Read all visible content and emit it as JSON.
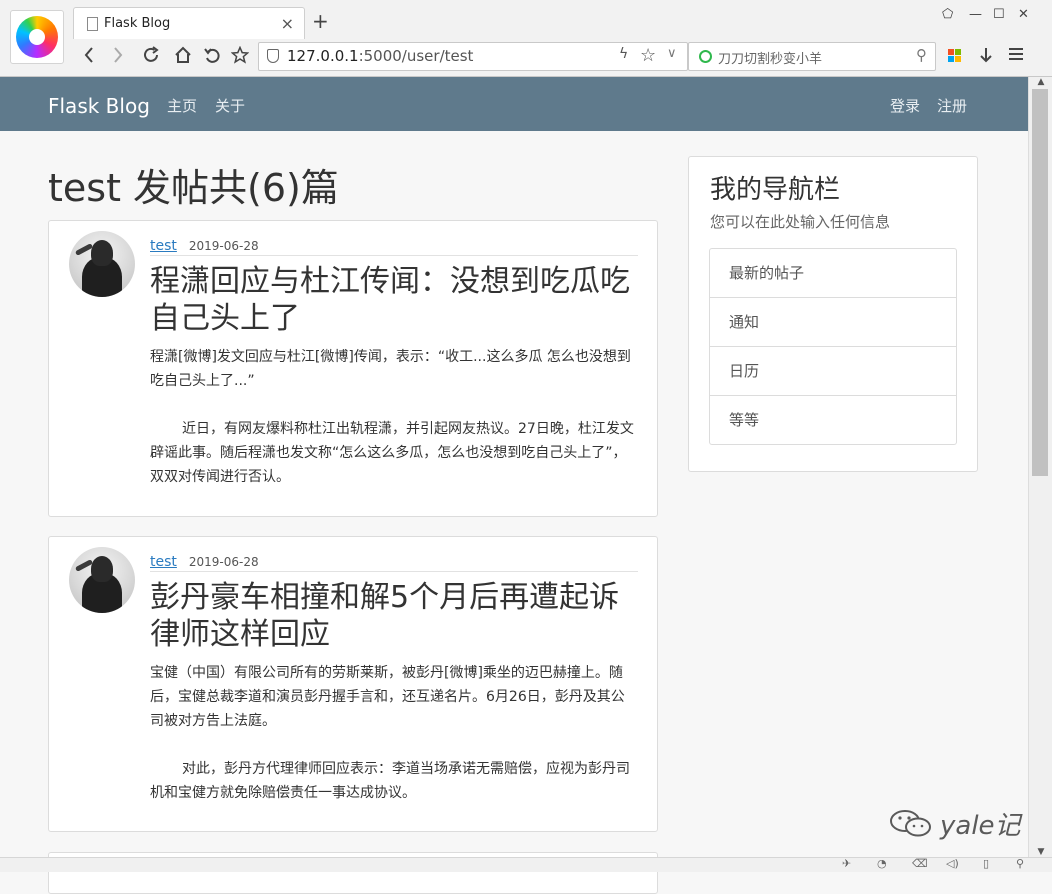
{
  "browser": {
    "tab_title": "Flask Blog",
    "tab_close": "×",
    "new_tab": "+",
    "url_host": "127.0.0.1",
    "url_rest": ":5000/user/test",
    "search_text": "刀刀切割秒变小羊",
    "window_controls": [
      "⬠",
      "—",
      "☐",
      "✕"
    ],
    "nav_icons": [
      "back-arrow-icon",
      "forward-arrow-icon",
      "refresh-icon",
      "home-icon",
      "undo-icon",
      "bookmark-star-icon"
    ]
  },
  "navbar": {
    "brand": "Flask Blog",
    "links": [
      "主页",
      "关于"
    ],
    "right_links": [
      "登录",
      "注册"
    ],
    "bg_color": "#5f7a8c"
  },
  "main": {
    "heading": "test 发帖共(6)篇"
  },
  "posts": [
    {
      "author": "test",
      "date": "2019-06-28",
      "title": "程潇回应与杜江传闻：没想到吃瓜吃自己头上了",
      "paragraphs": [
        "程潇[微博]发文回应与杜江[微博]传闻，表示：“收工...这么多瓜 怎么也没想到吃自己头上了...”",
        "近日，有网友爆料称杜江出轨程潇，并引起网友热议。27日晚，杜江发文辟谣此事。随后程潇也发文称“怎么这么多瓜，怎么也没想到吃自己头上了”，双双对传闻进行否认。"
      ]
    },
    {
      "author": "test",
      "date": "2019-06-28",
      "title": "彭丹豪车相撞和解5个月后再遭起诉 律师这样回应",
      "paragraphs": [
        "宝健（中国）有限公司所有的劳斯莱斯，被彭丹[微博]乘坐的迈巴赫撞上。随后，宝健总裁李道和演员彭丹握手言和，还互递名片。6月26日，彭丹及其公司被对方告上法庭。",
        "对此，彭丹方代理律师回应表示：李道当场承诺无需赔偿，应视为彭丹司机和宝健方就免除赔偿责任一事达成协议。"
      ]
    }
  ],
  "sidebar": {
    "title": "我的导航栏",
    "subtitle": "您可以在此处输入任何信息",
    "items": [
      "最新的帖子",
      "通知",
      "日历",
      "等等"
    ]
  },
  "watermark": {
    "text": "yale记"
  }
}
